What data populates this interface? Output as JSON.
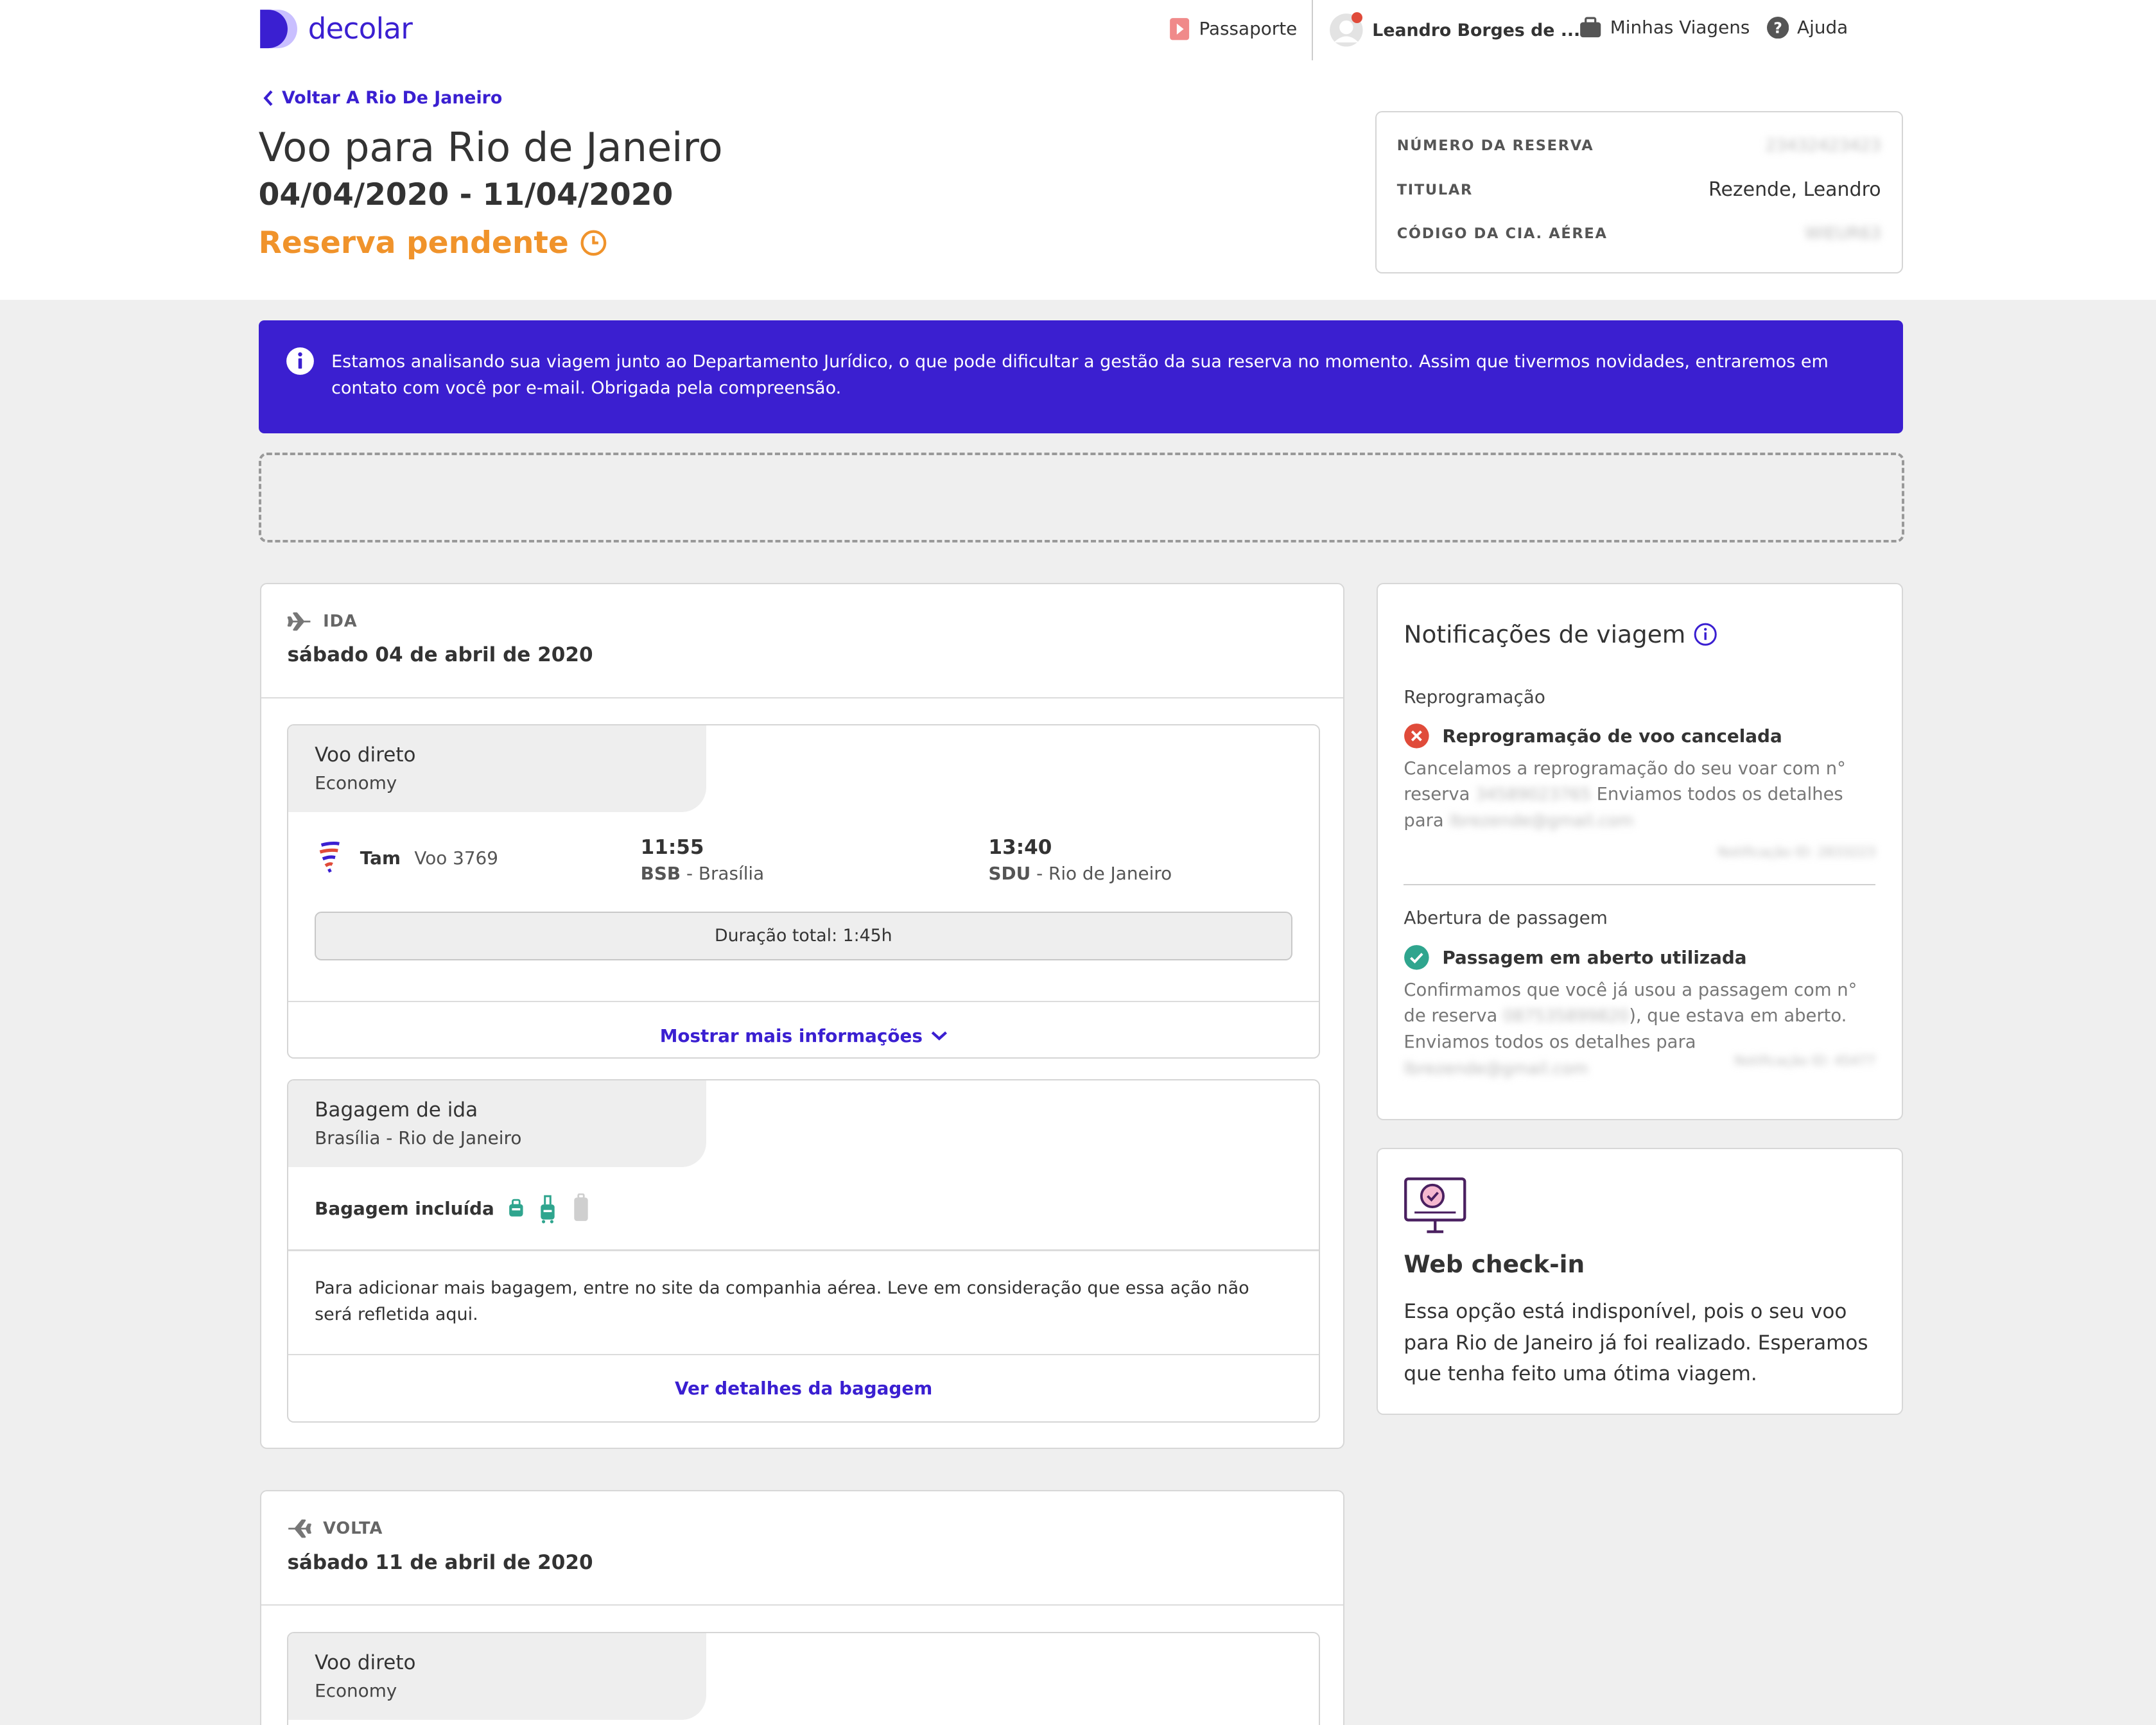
{
  "header": {
    "logo_text": "decolar",
    "nav": {
      "passport": "Passaporte",
      "user": "Leandro Borges de ...",
      "trips": "Minhas Viagens",
      "help": "Ajuda"
    }
  },
  "page": {
    "back_link": "Voltar A Rio De Janeiro",
    "title": "Voo para Rio de Janeiro",
    "dates": "04/04/2020 - 11/04/2020",
    "status": "Reserva pendente",
    "status_color": "#f0932b"
  },
  "reservation": {
    "number_label": "NÚMERO DA RESERVA",
    "number_value": "23432423423",
    "holder_label": "TITULAR",
    "holder_value": "Rezende, Leandro",
    "airline_code_label": "CÓDIGO DA CIA. AÉREA",
    "airline_code_value": "WIEUR63"
  },
  "banner": {
    "text": "Estamos analisando sua viagem junto ao Departamento Jurídico, o que pode dificultar a gestão da sua reserva no momento. Assim que tivermos novidades, entraremos em contato com você por e-mail. Obrigada pela compreensão.",
    "color": "#3b1fd0"
  },
  "outbound": {
    "direction": "IDA",
    "date": "sábado 04 de abril de 2020",
    "flight": {
      "type": "Voo direto",
      "cabin": "Economy",
      "airline": "Tam",
      "flight_number": "Voo 3769",
      "dep_time": "11:55",
      "dep_code": "BSB",
      "dep_city": "Brasília",
      "arr_time": "13:40",
      "arr_code": "SDU",
      "arr_city": "Rio de Janeiro",
      "duration": "Duração total: 1:45h",
      "more_info": "Mostrar mais informações"
    },
    "baggage": {
      "title": "Bagagem de ida",
      "route": "Brasília - Rio de Janeiro",
      "included_label": "Bagagem incluída",
      "note": "Para adicionar mais bagagem, entre no site da companhia aérea. Leve em consideração que essa ação não será refletida aqui.",
      "details_link": "Ver detalhes da bagagem"
    }
  },
  "return": {
    "direction": "VOLTA",
    "date": "sábado 11 de abril de 2020",
    "flight": {
      "type": "Voo direto",
      "cabin": "Economy"
    }
  },
  "notifications": {
    "title": "Notificações de viagem",
    "items": [
      {
        "section": "Reprogramação",
        "heading": "Reprogramação de voo cancelada",
        "body_1": "Cancelamos a reprogramação do seu voar com n° reserva",
        "body_blur_1": "34589023765",
        "body_2": "Enviamos todos os detalhes para",
        "body_blur_2": "lbrezende@gmail.com",
        "footer_blur": "Notificação ID: 2833223",
        "status": "error",
        "status_color": "#e04b3a"
      },
      {
        "section": "Abertura de passagem",
        "heading": "Passagem em aberto utilizada",
        "body_1": "Confirmamos que você já usou a passagem com n° de reserva",
        "body_blur_1": "087535899820",
        "body_2": "), que estava em aberto. Enviamos todos os detalhes para",
        "body_blur_2": "lbrezende@gmail.com",
        "footer_blur": "Notificação ID: 45477",
        "status": "success",
        "status_color": "#2fa58e"
      }
    ]
  },
  "checkin": {
    "title": "Web check-in",
    "text": "Essa opção está indisponível, pois o seu voo para Rio de Janeiro já foi realizado. Esperamos que tenha feito uma ótima viagem."
  }
}
